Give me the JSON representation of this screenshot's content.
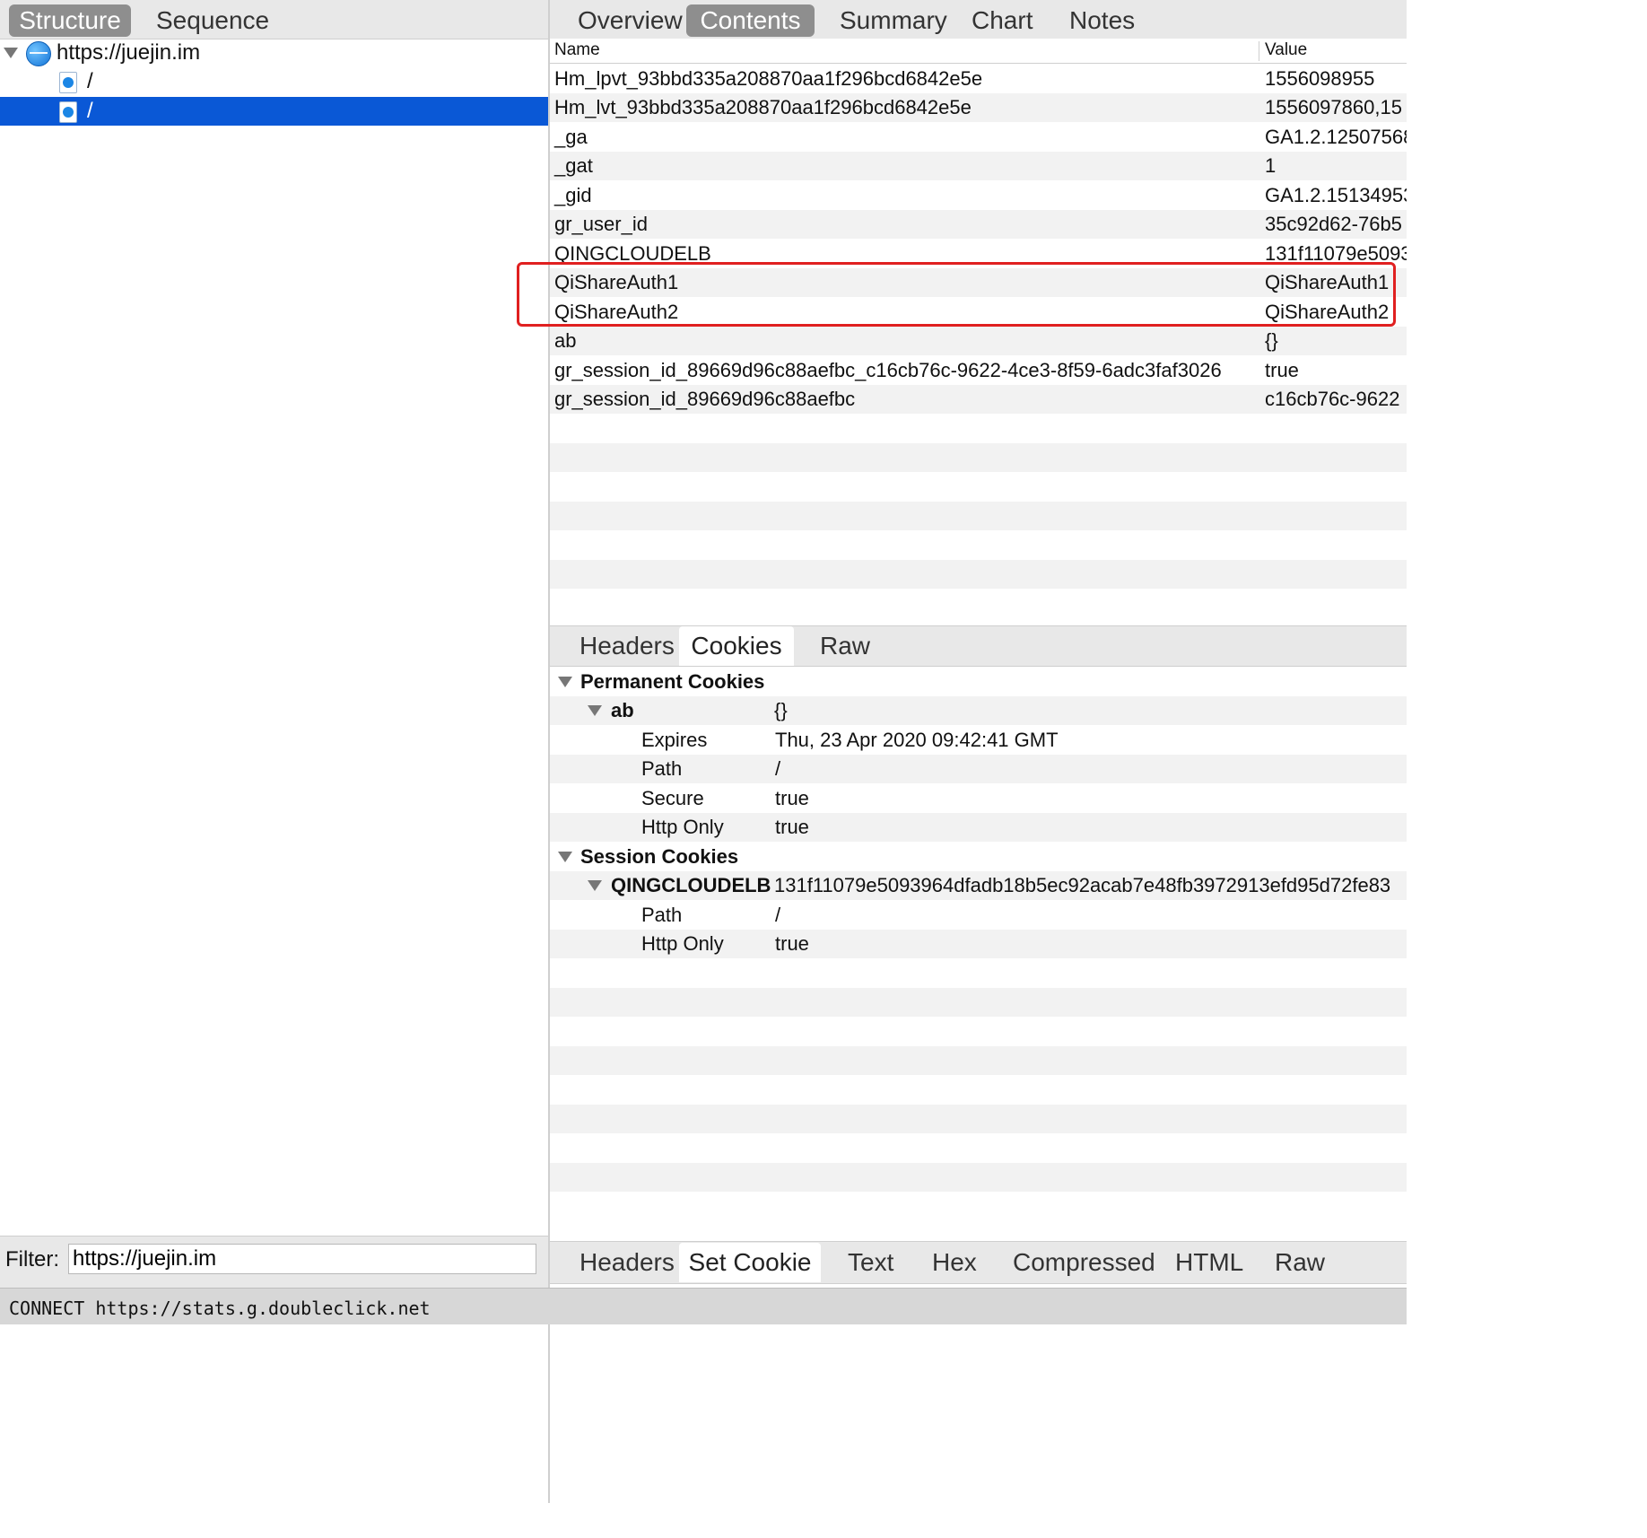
{
  "left_tabs": [
    "Structure",
    "Sequence"
  ],
  "tree": {
    "host": "https://juejin.im",
    "children": [
      "/",
      "/"
    ]
  },
  "filter": {
    "label": "Filter:",
    "value": "https://juejin.im"
  },
  "status_text": "CONNECT https://stats.g.doubleclick.net",
  "right_tabs": [
    "Overview",
    "Contents",
    "Summary",
    "Chart",
    "Notes"
  ],
  "columns": {
    "name": "Name",
    "value": "Value"
  },
  "cookies_table": [
    {
      "name": "Hm_lpvt_93bbd335a208870aa1f296bcd6842e5e",
      "value": "1556098955"
    },
    {
      "name": "Hm_lvt_93bbd335a208870aa1f296bcd6842e5e",
      "value": "1556097860,15"
    },
    {
      "name": "_ga",
      "value": "GA1.2.12507568"
    },
    {
      "name": "_gat",
      "value": "1"
    },
    {
      "name": "_gid",
      "value": "GA1.2.15134953"
    },
    {
      "name": "gr_user_id",
      "value": "35c92d62-76b5"
    },
    {
      "name": "QINGCLOUDELB",
      "value": "131f11079e5093"
    },
    {
      "name": "QiShareAuth1",
      "value": "QiShareAuth1"
    },
    {
      "name": "QiShareAuth2",
      "value": "QiShareAuth2"
    },
    {
      "name": "ab",
      "value": "{}"
    },
    {
      "name": "gr_session_id_89669d96c88aefbc_c16cb76c-9622-4ce3-8f59-6adc3faf3026",
      "value": "true"
    },
    {
      "name": "gr_session_id_89669d96c88aefbc",
      "value": "c16cb76c-9622"
    }
  ],
  "mid_tabs": [
    "Headers",
    "Cookies",
    "Raw"
  ],
  "permanent_cookies": {
    "title": "Permanent Cookies",
    "name": "ab",
    "value": "{}",
    "attrs": [
      {
        "k": "Expires",
        "v": "Thu, 23 Apr 2020 09:42:41 GMT"
      },
      {
        "k": "Path",
        "v": "/"
      },
      {
        "k": "Secure",
        "v": "true"
      },
      {
        "k": "Http Only",
        "v": "true"
      }
    ]
  },
  "session_cookies": {
    "title": "Session Cookies",
    "name": "QINGCLOUDELB",
    "value": "131f11079e5093964dfadb18b5ec92acab7e48fb3972913efd95d72fe83",
    "attrs": [
      {
        "k": "Path",
        "v": "/"
      },
      {
        "k": "Http Only",
        "v": "true"
      }
    ]
  },
  "bottom_tabs": [
    "Headers",
    "Set Cookie",
    "Text",
    "Hex",
    "Compressed",
    "HTML",
    "Raw"
  ],
  "colors": {
    "selection": "#0a58d6",
    "highlight_box": "#e02020",
    "tab_active": "#8e8e8e"
  }
}
